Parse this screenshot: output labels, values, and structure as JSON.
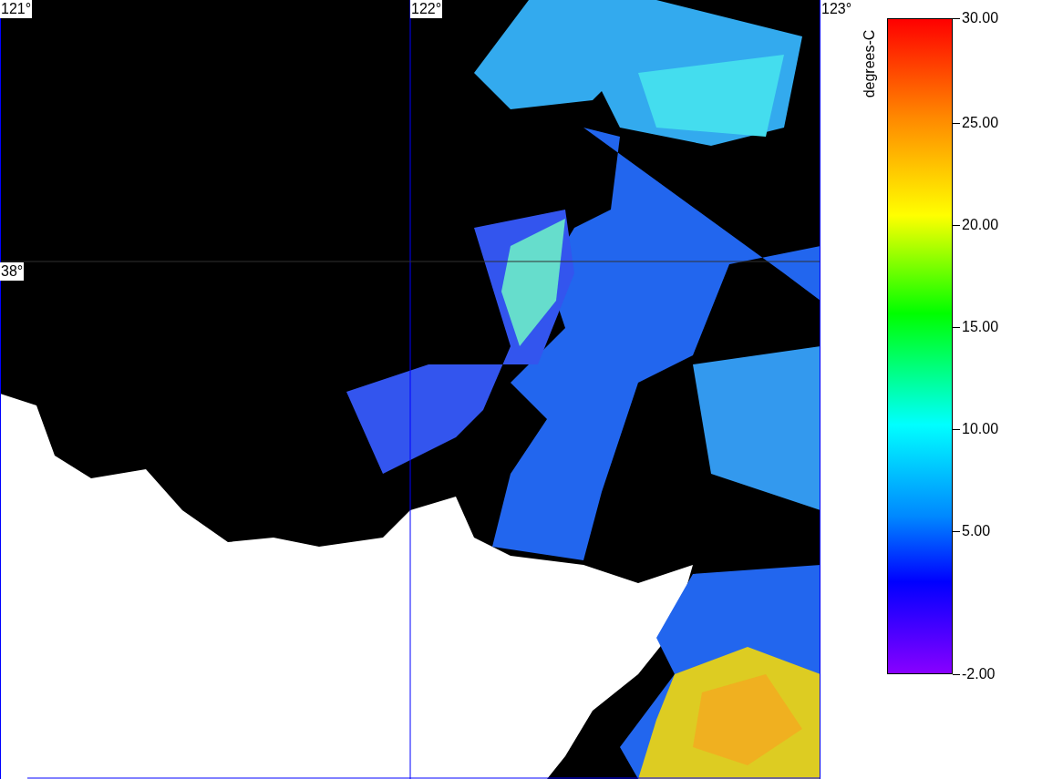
{
  "map": {
    "lon_labels": [
      "121°",
      "122°",
      "123°"
    ],
    "lat_labels": [
      "38°"
    ]
  },
  "colorbar": {
    "title": "degrees-C",
    "ticks": [
      "30.00",
      "25.00",
      "20.00",
      "15.00",
      "10.00",
      "5.00",
      "-2.00"
    ]
  }
}
